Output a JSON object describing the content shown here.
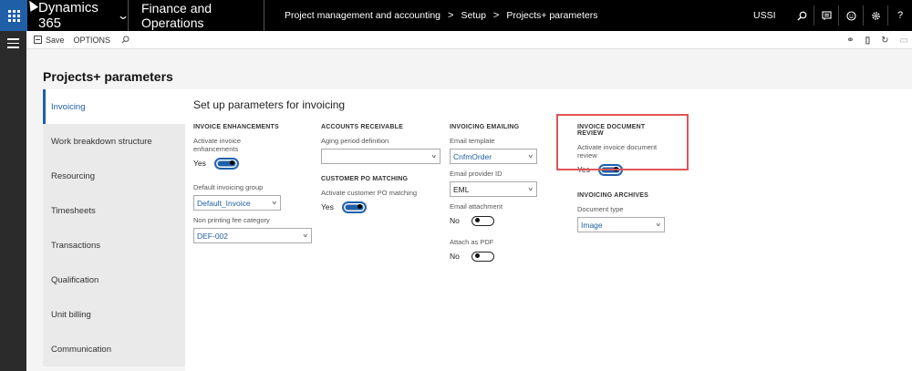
{
  "topbar": {
    "app_name": "Dynamics 365",
    "app_chevron": "⌄",
    "module": "Finance and Operations",
    "breadcrumb": [
      "Project management and accounting",
      "Setup",
      "Projects+ parameters"
    ],
    "breadcrumb_sep": ">",
    "company": "USSI",
    "icons": [
      "search-icon",
      "message-icon",
      "smiley-icon",
      "settings-icon",
      "help-icon"
    ],
    "help_label": "?"
  },
  "actionbar": {
    "save_label": "Save",
    "options_label": "OPTIONS",
    "right_icons": [
      "link-icon",
      "office-icon",
      "refresh-icon",
      "popout-icon"
    ]
  },
  "page": {
    "title": "Projects+ parameters"
  },
  "tabs": [
    {
      "label": "Invoicing",
      "active": true
    },
    {
      "label": "Work breakdown structure",
      "active": false
    },
    {
      "label": "Resourcing",
      "active": false
    },
    {
      "label": "Timesheets",
      "active": false
    },
    {
      "label": "Transactions",
      "active": false
    },
    {
      "label": "Qualification",
      "active": false
    },
    {
      "label": "Unit billing",
      "active": false
    },
    {
      "label": "Communication",
      "active": false
    }
  ],
  "content": {
    "title": "Set up parameters for invoicing",
    "invoice_enhancements": {
      "header": "INVOICE ENHANCEMENTS",
      "activate_label": "Activate invoice enhancements",
      "activate_value": "Yes",
      "default_group_label": "Default invoicing group",
      "default_group_value": "Default_Invoice",
      "non_printing_label": "Non printing fee category",
      "non_printing_value": "DEF-002"
    },
    "accounts_receivable": {
      "header": "ACCOUNTS RECEIVABLE",
      "aging_label": "Aging period definition",
      "aging_value": ""
    },
    "customer_po": {
      "header": "CUSTOMER PO MATCHING",
      "activate_label": "Activate customer PO matching",
      "activate_value": "Yes"
    },
    "invoicing_emailing": {
      "header": "INVOICING EMAILING",
      "template_label": "Email template",
      "template_value": "CnfmOrder",
      "provider_label": "Email provider ID",
      "provider_value": "EML",
      "attachment_label": "Email attachment",
      "attachment_value": "No",
      "pdf_label": "Attach as PDF",
      "pdf_value": "No"
    },
    "document_review": {
      "header": "INVOICE DOCUMENT REVIEW",
      "activate_label": "Activate invoice document review",
      "activate_value": "Yes"
    },
    "invoicing_archives": {
      "header": "INVOICING ARCHIVES",
      "doc_type_label": "Document type",
      "doc_type_value": "Image"
    }
  },
  "colors": {
    "accent": "#1f5fa8",
    "highlight": "#e05555",
    "topbar": "#000000"
  }
}
